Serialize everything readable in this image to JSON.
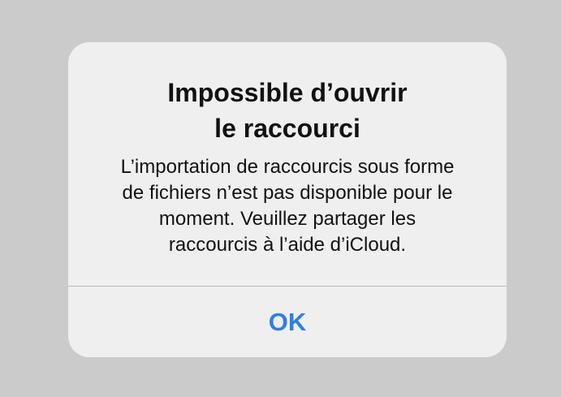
{
  "alert": {
    "title_line1": "Impossible d’ouvrir",
    "title_line2": "le raccourci",
    "message_line1": "L’importation de raccourcis sous forme",
    "message_line2": "de fichiers n’est pas disponible pour le",
    "message_line3": "moment. Veuillez partager les",
    "message_line4": "raccourcis à l’aide d’iCloud.",
    "ok_label": "OK"
  },
  "colors": {
    "background": "#cbcbcb",
    "alert_background": "#efefef",
    "accent": "#2f7fe0",
    "text": "#111111",
    "divider": "#b9b9b9"
  }
}
